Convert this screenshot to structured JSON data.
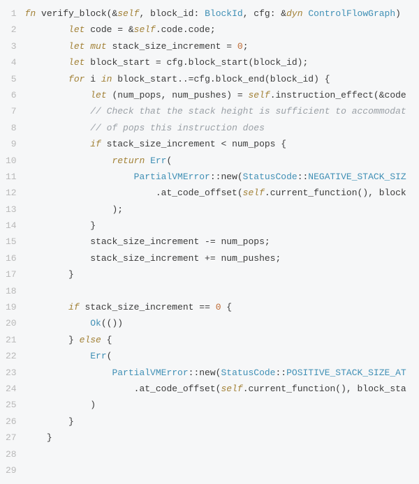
{
  "code": {
    "lines": [
      {
        "num": "1",
        "tokens": [
          {
            "cls": "kw",
            "t": "fn "
          },
          {
            "cls": "fn-name",
            "t": "verify_block"
          },
          {
            "cls": "paren",
            "t": "(&"
          },
          {
            "cls": "self",
            "t": "self"
          },
          {
            "cls": "paren",
            "t": ", block_id: "
          },
          {
            "cls": "type",
            "t": "BlockId"
          },
          {
            "cls": "paren",
            "t": ", cfg: &"
          },
          {
            "cls": "kw",
            "t": "dyn "
          },
          {
            "cls": "type",
            "t": "ControlFlowGraph"
          },
          {
            "cls": "paren",
            "t": ")"
          }
        ],
        "indent": 0
      },
      {
        "num": "2",
        "tokens": [
          {
            "cls": "kw",
            "t": "let"
          },
          {
            "cls": "ident",
            "t": " code = &"
          },
          {
            "cls": "self",
            "t": "self"
          },
          {
            "cls": "ident",
            "t": ".code.code;"
          }
        ],
        "indent": 2
      },
      {
        "num": "3",
        "tokens": [
          {
            "cls": "kw",
            "t": "let"
          },
          {
            "cls": "ident",
            "t": " "
          },
          {
            "cls": "kw",
            "t": "mut"
          },
          {
            "cls": "ident",
            "t": " stack_size_increment = "
          },
          {
            "cls": "num",
            "t": "0"
          },
          {
            "cls": "ident",
            "t": ";"
          }
        ],
        "indent": 2
      },
      {
        "num": "4",
        "tokens": [
          {
            "cls": "kw",
            "t": "let"
          },
          {
            "cls": "ident",
            "t": " block_start = cfg.block_start(block_id);"
          }
        ],
        "indent": 2
      },
      {
        "num": "5",
        "tokens": [
          {
            "cls": "kw",
            "t": "for"
          },
          {
            "cls": "ident",
            "t": " i "
          },
          {
            "cls": "kw",
            "t": "in"
          },
          {
            "cls": "ident",
            "t": " block_start..=cfg.block_end(block_id) {"
          }
        ],
        "indent": 2
      },
      {
        "num": "6",
        "tokens": [
          {
            "cls": "kw",
            "t": "let"
          },
          {
            "cls": "ident",
            "t": " (num_pops, num_pushes) = "
          },
          {
            "cls": "self",
            "t": "self"
          },
          {
            "cls": "ident",
            "t": ".instruction_effect(&code"
          }
        ],
        "indent": 3
      },
      {
        "num": "7",
        "tokens": [
          {
            "cls": "comment",
            "t": "// Check that the stack height is sufficient to accommodat"
          }
        ],
        "indent": 3
      },
      {
        "num": "8",
        "tokens": [
          {
            "cls": "comment",
            "t": "// of pops this instruction does"
          }
        ],
        "indent": 3
      },
      {
        "num": "9",
        "tokens": [
          {
            "cls": "kw",
            "t": "if"
          },
          {
            "cls": "ident",
            "t": " stack_size_increment < num_pops {"
          }
        ],
        "indent": 3
      },
      {
        "num": "10",
        "tokens": [
          {
            "cls": "kw",
            "t": "return"
          },
          {
            "cls": "ident",
            "t": " "
          },
          {
            "cls": "variant",
            "t": "Err"
          },
          {
            "cls": "paren",
            "t": "("
          }
        ],
        "indent": 4
      },
      {
        "num": "11",
        "tokens": [
          {
            "cls": "type",
            "t": "PartialVMError"
          },
          {
            "cls": "ident",
            "t": "::new("
          },
          {
            "cls": "type",
            "t": "StatusCode"
          },
          {
            "cls": "ident",
            "t": "::"
          },
          {
            "cls": "constant",
            "t": "NEGATIVE_STACK_SIZ"
          }
        ],
        "indent": 5
      },
      {
        "num": "12",
        "tokens": [
          {
            "cls": "ident",
            "t": ".at_code_offset("
          },
          {
            "cls": "self",
            "t": "self"
          },
          {
            "cls": "ident",
            "t": ".current_function(), block"
          }
        ],
        "indent": 6
      },
      {
        "num": "13",
        "tokens": [
          {
            "cls": "paren",
            "t": ");"
          }
        ],
        "indent": 4
      },
      {
        "num": "14",
        "tokens": [
          {
            "cls": "paren",
            "t": "}"
          }
        ],
        "indent": 3
      },
      {
        "num": "15",
        "tokens": [
          {
            "cls": "ident",
            "t": "stack_size_increment -= num_pops;"
          }
        ],
        "indent": 3
      },
      {
        "num": "16",
        "tokens": [
          {
            "cls": "ident",
            "t": "stack_size_increment += num_pushes;"
          }
        ],
        "indent": 3
      },
      {
        "num": "17",
        "tokens": [
          {
            "cls": "paren",
            "t": "}"
          }
        ],
        "indent": 2
      },
      {
        "num": "18",
        "tokens": [],
        "indent": 0
      },
      {
        "num": "19",
        "tokens": [
          {
            "cls": "kw",
            "t": "if"
          },
          {
            "cls": "ident",
            "t": " stack_size_increment == "
          },
          {
            "cls": "num",
            "t": "0"
          },
          {
            "cls": "ident",
            "t": " {"
          }
        ],
        "indent": 2
      },
      {
        "num": "20",
        "tokens": [
          {
            "cls": "variant",
            "t": "Ok"
          },
          {
            "cls": "paren",
            "t": "(())"
          }
        ],
        "indent": 3
      },
      {
        "num": "21",
        "tokens": [
          {
            "cls": "paren",
            "t": "} "
          },
          {
            "cls": "kw",
            "t": "else"
          },
          {
            "cls": "paren",
            "t": " {"
          }
        ],
        "indent": 2
      },
      {
        "num": "22",
        "tokens": [
          {
            "cls": "variant",
            "t": "Err"
          },
          {
            "cls": "paren",
            "t": "("
          }
        ],
        "indent": 3
      },
      {
        "num": "23",
        "tokens": [
          {
            "cls": "type",
            "t": "PartialVMError"
          },
          {
            "cls": "ident",
            "t": "::new("
          },
          {
            "cls": "type",
            "t": "StatusCode"
          },
          {
            "cls": "ident",
            "t": "::"
          },
          {
            "cls": "constant",
            "t": "POSITIVE_STACK_SIZE_AT"
          }
        ],
        "indent": 4
      },
      {
        "num": "24",
        "tokens": [
          {
            "cls": "ident",
            "t": ".at_code_offset("
          },
          {
            "cls": "self",
            "t": "self"
          },
          {
            "cls": "ident",
            "t": ".current_function(), block_sta"
          }
        ],
        "indent": 5
      },
      {
        "num": "25",
        "tokens": [
          {
            "cls": "paren",
            "t": ")"
          }
        ],
        "indent": 3
      },
      {
        "num": "26",
        "tokens": [
          {
            "cls": "paren",
            "t": "}"
          }
        ],
        "indent": 2
      },
      {
        "num": "27",
        "tokens": [
          {
            "cls": "paren",
            "t": "}"
          }
        ],
        "indent": 1
      },
      {
        "num": "28",
        "tokens": [],
        "indent": 0
      },
      {
        "num": "29",
        "tokens": [],
        "indent": 0
      }
    ],
    "indent_unit": "    "
  }
}
